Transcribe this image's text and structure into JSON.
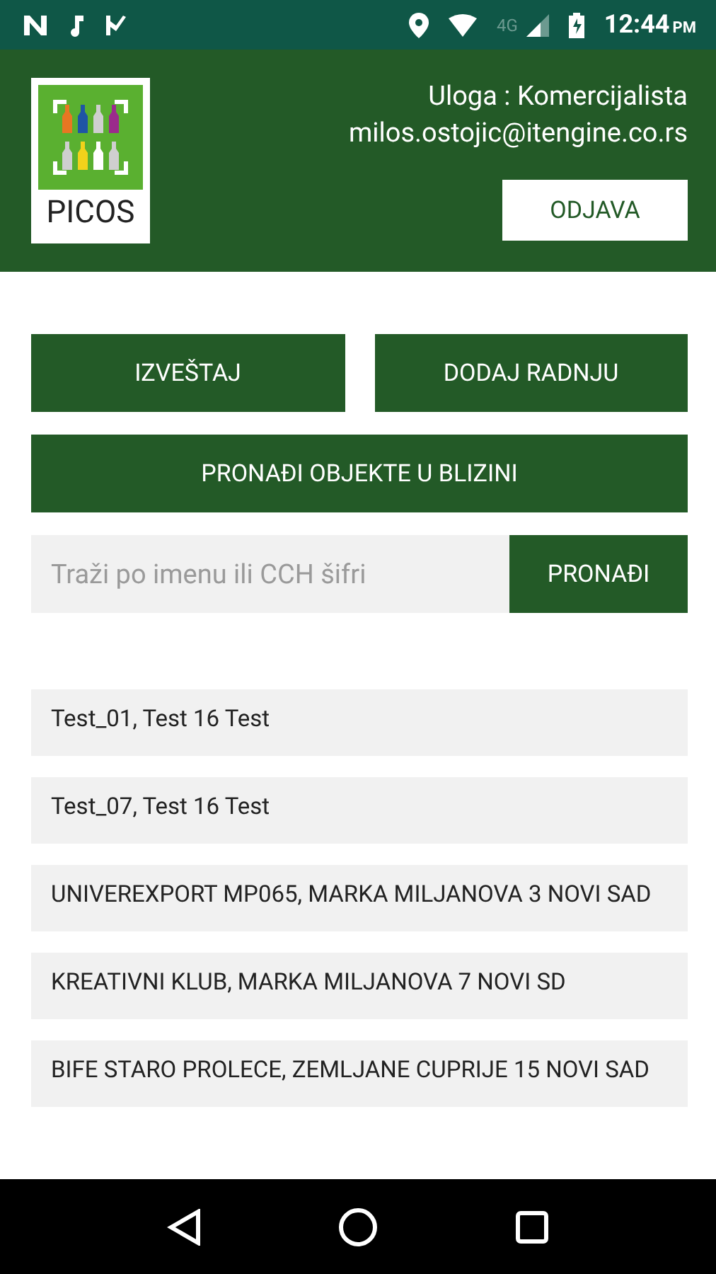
{
  "status_bar": {
    "network": "4G",
    "time": "12:44",
    "period": "PM"
  },
  "header": {
    "logo_text": "PICOS",
    "role": "Uloga : Komercijalista",
    "email": "milos.ostojic@itengine.co.rs",
    "logout": "ODJAVA"
  },
  "actions": [
    {
      "label": "IZVEŠTAJ"
    },
    {
      "label": "DODAJ RADNJU"
    }
  ],
  "nearby_button": "PRONAĐI OBJEKTE U BLIZINI",
  "search": {
    "placeholder": "Traži po imenu ili CCH šifri",
    "button": "PRONAĐI"
  },
  "results": [
    {
      "text": "Test_01, Test 16 Test"
    },
    {
      "text": "Test_07, Test 16 Test"
    },
    {
      "text": "UNIVEREXPORT MP065, MARKA MILJANOVA 3 NOVI SAD"
    },
    {
      "text": "KREATIVNI KLUB, MARKA MILJANOVA 7 NOVI SD"
    },
    {
      "text": "BIFE STARO PROLECE, ZEMLJANE CUPRIJE 15 NOVI SAD"
    }
  ]
}
